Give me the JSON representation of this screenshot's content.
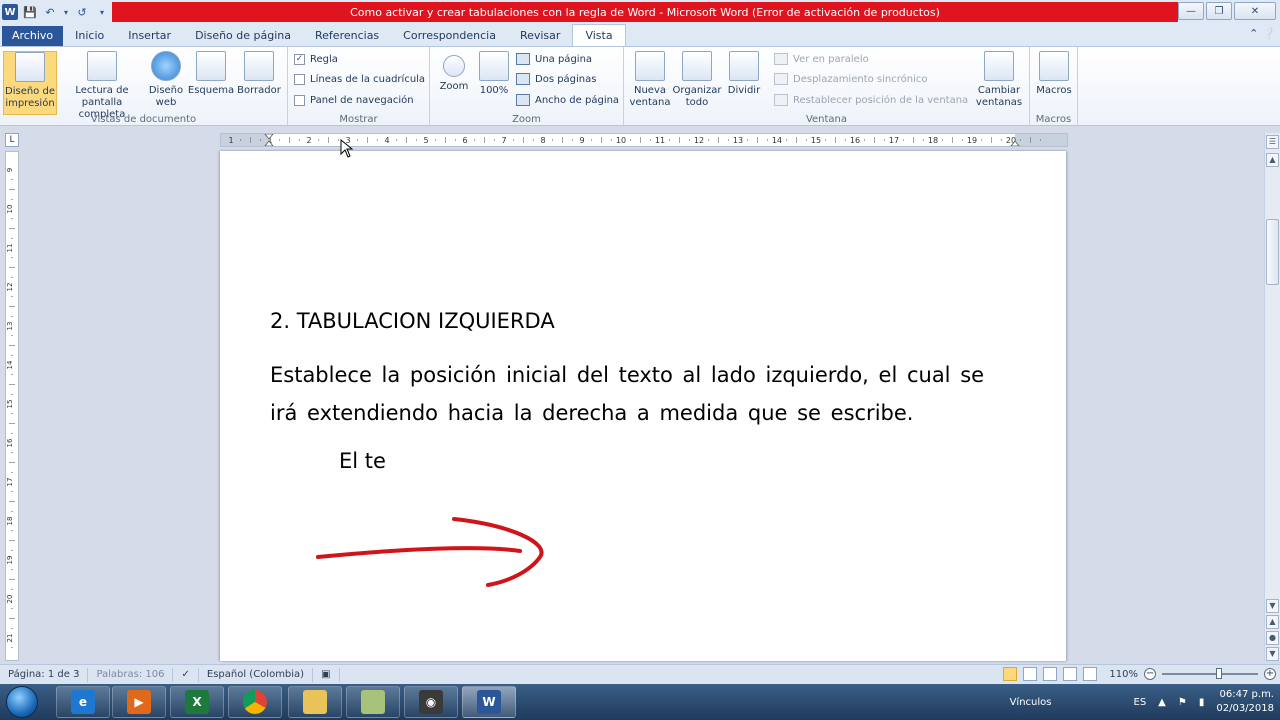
{
  "window": {
    "title": "Como activar y crear tabulaciones con la regla de Word  -  Microsoft Word (Error de activación de productos)",
    "qat_icons": [
      "word-logo-icon",
      "save-icon",
      "undo-icon",
      "redo-icon",
      "customize-qat-icon"
    ]
  },
  "tabs": [
    {
      "label": "Archivo",
      "state": "file"
    },
    {
      "label": "Inicio"
    },
    {
      "label": "Insertar"
    },
    {
      "label": "Diseño de página"
    },
    {
      "label": "Referencias"
    },
    {
      "label": "Correspondencia"
    },
    {
      "label": "Revisar"
    },
    {
      "label": "Vista",
      "state": "active"
    }
  ],
  "ribbon": {
    "vistas": {
      "title": "Vistas de documento",
      "diseno_impresion": "Diseño de impresión",
      "lectura": "Lectura de pantalla completa",
      "diseno_web": "Diseño web",
      "esquema": "Esquema",
      "borrador": "Borrador"
    },
    "mostrar": {
      "title": "Mostrar",
      "regla": "Regla",
      "regla_checked": true,
      "lineas": "Líneas de la cuadrícula",
      "panel": "Panel de navegación"
    },
    "zoom": {
      "title": "Zoom",
      "zoom": "Zoom",
      "cien": "100%",
      "una_pagina": "Una página",
      "dos_paginas": "Dos páginas",
      "ancho_pagina": "Ancho de página"
    },
    "ventana": {
      "title": "Ventana",
      "nueva": "Nueva ventana",
      "organizar": "Organizar todo",
      "dividir": "Dividir",
      "ver_paralelo": "Ver en paralelo",
      "desplazamiento": "Desplazamiento sincrónico",
      "restablecer": "Restablecer posición de la ventana",
      "cambiar": "Cambiar ventanas"
    },
    "macros": {
      "title": "Macros",
      "macros": "Macros"
    }
  },
  "ruler": {
    "labels": [
      "1",
      "1",
      "2",
      "3",
      "4",
      "5",
      "6",
      "7",
      "8",
      "9",
      "10",
      "11",
      "12",
      "13",
      "14",
      "15",
      "16",
      "17",
      "18",
      "19",
      "20"
    ],
    "vertical_labels": [
      "9",
      "10",
      "11",
      "12",
      "13",
      "14",
      "15",
      "16",
      "17",
      "18",
      "19",
      "20",
      "21"
    ]
  },
  "document": {
    "heading": "2.  TABULACION IZQUIERDA",
    "paragraph": "Establece la posición inicial del texto al lado izquierdo, el cual se irá extendiendo hacia la derecha a medida que se escribe.",
    "tabbed_text": "El te",
    "annotation_color": "#d0141c"
  },
  "statusbar": {
    "pagina": "Página: 1 de 3",
    "palabras": "Palabras: 106",
    "idioma": "Español (Colombia)",
    "zoom": "110%"
  },
  "taskbar": {
    "apps": [
      "internet-explorer-icon",
      "media-player-icon",
      "excel-icon",
      "chrome-icon",
      "file-explorer-icon",
      "notes-icon",
      "camera-icon",
      "word-icon"
    ],
    "vinculos": "Vínculos",
    "lang": "ES",
    "time": "06:47 p.m.",
    "date": "02/03/2018"
  }
}
